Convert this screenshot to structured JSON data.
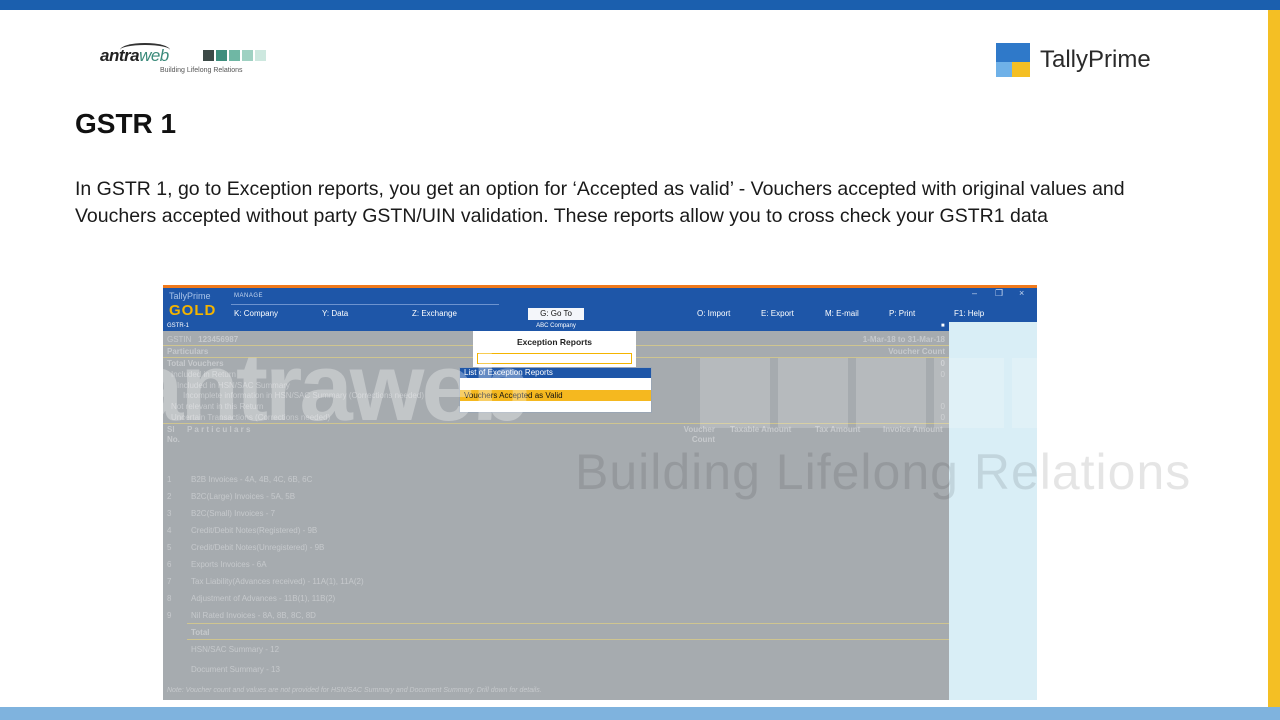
{
  "slide": {
    "title": "GSTR 1",
    "body": "In GSTR 1, go to Exception reports, you get an option for ‘Accepted as valid’ - Vouchers accepted with original values and Vouchers accepted without party GSTN/UIN validation. These reports allow you to cross check your GSTR1 data"
  },
  "logo": {
    "prefix": "antra",
    "suffix": "web",
    "tagline": "Building Lifelong Relations"
  },
  "brand": {
    "name": "TallyPrime"
  },
  "colors": {
    "top_bar": "#1b5fae",
    "bottom_bar": "#7fb3de",
    "right_bar": "#f4bf24",
    "tally_header": "#1e56a8",
    "highlight": "#f5b81f"
  },
  "tally": {
    "brand": "TallyPrime",
    "edition": "GOLD",
    "manage": "MANAGE",
    "menu": [
      "K: Company",
      "Y: Data",
      "Z: Exchange",
      "G: Go To",
      "O: Import",
      "E: Export",
      "M: E-mail",
      "P: Print",
      "F1: Help"
    ],
    "window_controls": [
      "–",
      "❐",
      "×"
    ],
    "report_name": "GSTR-1",
    "company": "ABC Company",
    "gstin_label": "GSTIN",
    "gstin": "123456987",
    "period": "1-Mar-18 to 31-Mar-18",
    "particulars": "Particulars",
    "voucher_count": "Voucher Count",
    "summary_rows": [
      {
        "label": "Total Vouchers",
        "value": "0"
      },
      {
        "label": "Included in Return",
        "value": "0"
      },
      {
        "label": "Included in HSN/SAC Summary",
        "value": ""
      },
      {
        "label": "Incomplete information in HSN/SAC Summary (Corrections needed)",
        "value": ""
      },
      {
        "label": "Not relevant in this Return",
        "value": "0"
      },
      {
        "label": "Uncertain Transactions (Corrections needed)",
        "value": "0"
      }
    ],
    "table_headers": {
      "sl": "Sl No.",
      "particulars": "P a r t i c u l a r s",
      "voucher_count": "Voucher Count",
      "taxable": "Taxable Amount",
      "tax": "Tax Amount",
      "invoice": "Invoice Amount"
    },
    "table_rows": [
      {
        "sl": "1",
        "label": "B2B Invoices - 4A, 4B, 4C, 6B, 6C"
      },
      {
        "sl": "2",
        "label": "B2C(Large) Invoices - 5A, 5B"
      },
      {
        "sl": "3",
        "label": "B2C(Small) Invoices - 7"
      },
      {
        "sl": "4",
        "label": "Credit/Debit Notes(Registered) - 9B"
      },
      {
        "sl": "5",
        "label": "Credit/Debit Notes(Unregistered) - 9B"
      },
      {
        "sl": "6",
        "label": "Exports Invoices - 6A"
      },
      {
        "sl": "7",
        "label": "Tax Liability(Advances received) - 11A(1), 11A(2)"
      },
      {
        "sl": "8",
        "label": "Adjustment of Advances - 11B(1), 11B(2)"
      },
      {
        "sl": "9",
        "label": "Nil Rated Invoices - 8A, 8B, 8C, 8D"
      }
    ],
    "total_label": "Total",
    "hsn_summary": "HSN/SAC Summary - 12",
    "document_summary": "Document Summary - 13",
    "note": "Note: Voucher count and values are not provided for HSN/SAC Summary and Document Summary. Drill down for details.",
    "popup": {
      "title": "Exception Reports",
      "list_header": "List of Exception Reports",
      "selected_item": "Vouchers Accepted as Valid"
    }
  },
  "watermark": {
    "word": "antraweb",
    "tagline": "Building Lifelong Relations"
  }
}
